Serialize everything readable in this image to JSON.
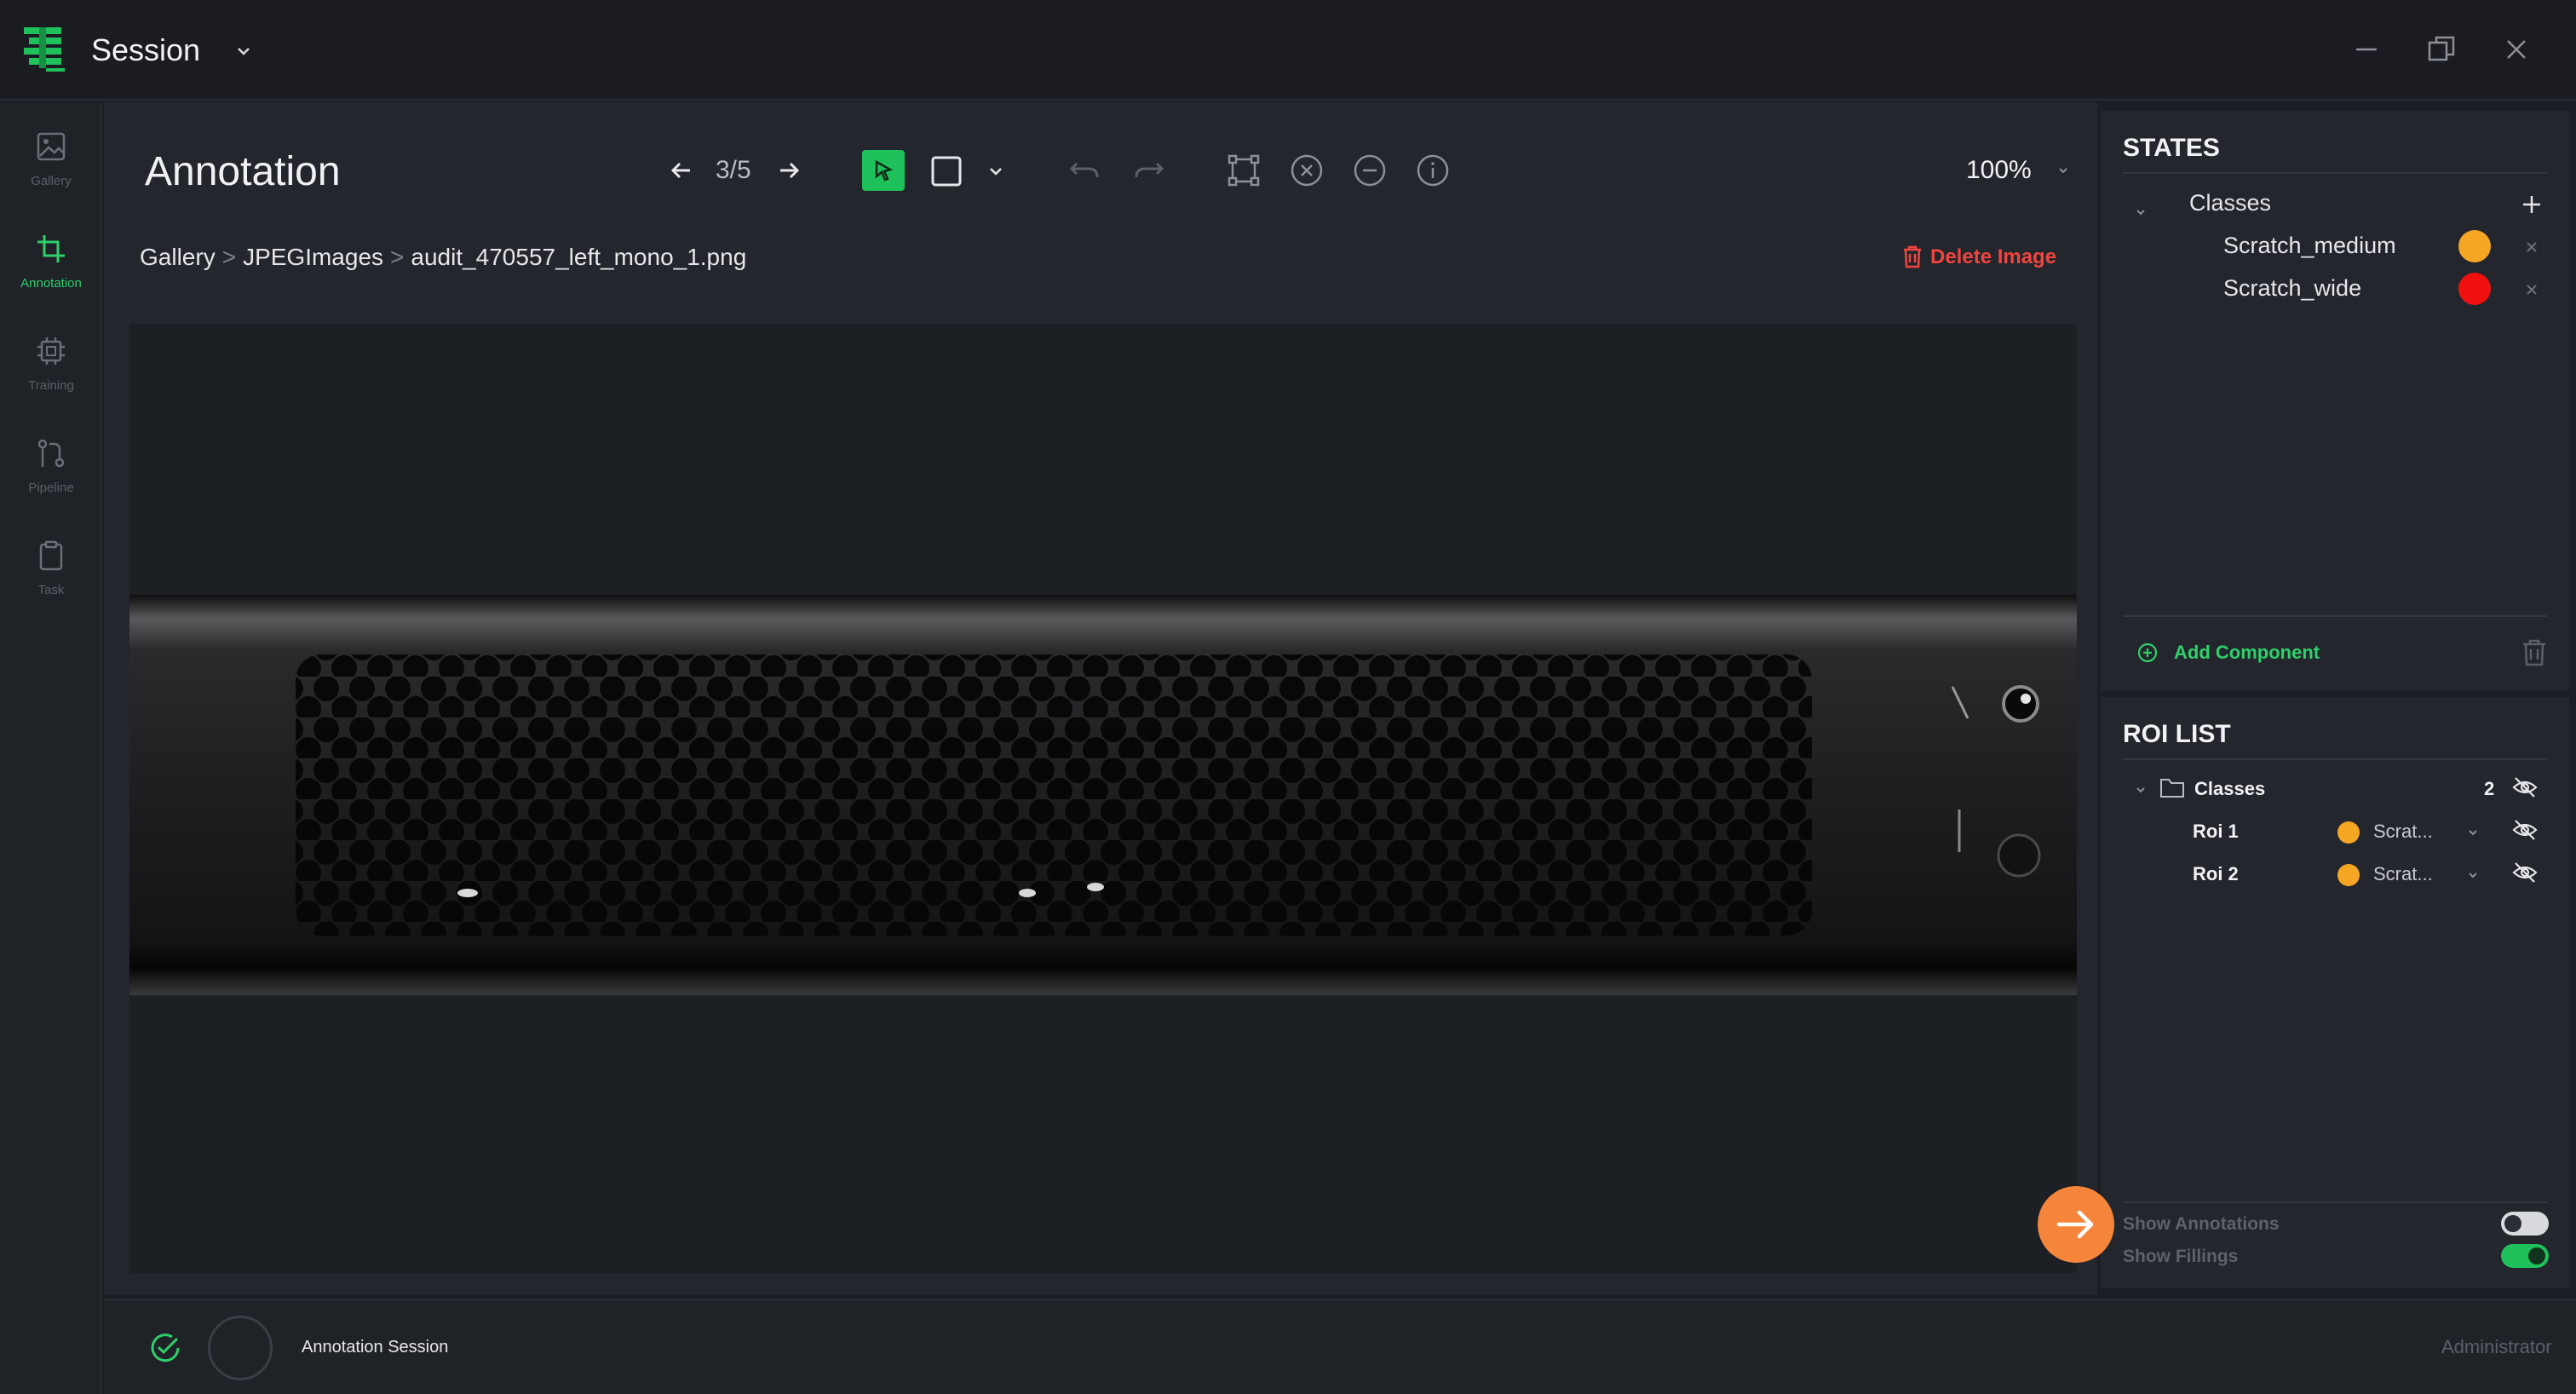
{
  "app": {
    "title": "Session",
    "brand_color": "#1fc15a",
    "accent_orange": "#f5853a"
  },
  "rail": {
    "items": [
      {
        "label": "Gallery",
        "icon": "image-icon",
        "active": false
      },
      {
        "label": "Annotation",
        "icon": "crop-icon",
        "active": true
      },
      {
        "label": "Training",
        "icon": "chip-icon",
        "active": false
      },
      {
        "label": "Pipeline",
        "icon": "pipeline-icon",
        "active": false
      },
      {
        "label": "Task",
        "icon": "clipboard-icon",
        "active": false
      }
    ]
  },
  "main": {
    "title": "Annotation",
    "nav": {
      "position": "3/5"
    },
    "zoom": "100%",
    "breadcrumb": [
      "Gallery",
      "JPEGImages",
      "audit_470557_left_mono_1.png"
    ],
    "breadcrumb_sep": ">",
    "delete_label": "Delete Image"
  },
  "states": {
    "heading": "STATES",
    "group_label": "Classes",
    "classes": [
      {
        "name": "Scratch_medium",
        "color": "#f5a623"
      },
      {
        "name": "Scratch_wide",
        "color": "#f01010"
      }
    ],
    "add_component_label": "Add Component"
  },
  "roi": {
    "heading": "ROI LIST",
    "group_label": "Classes",
    "group_count": "2",
    "items": [
      {
        "name": "Roi 1",
        "class": "Scrat...",
        "color": "#f5a623"
      },
      {
        "name": "Roi 2",
        "class": "Scrat...",
        "color": "#f5a623"
      }
    ]
  },
  "toggles": {
    "show_annotations": {
      "label": "Show Annotations",
      "on": false
    },
    "show_fillings": {
      "label": "Show Fillings",
      "on": true
    }
  },
  "status": {
    "session": "Annotation Session",
    "user": "Administrator"
  }
}
